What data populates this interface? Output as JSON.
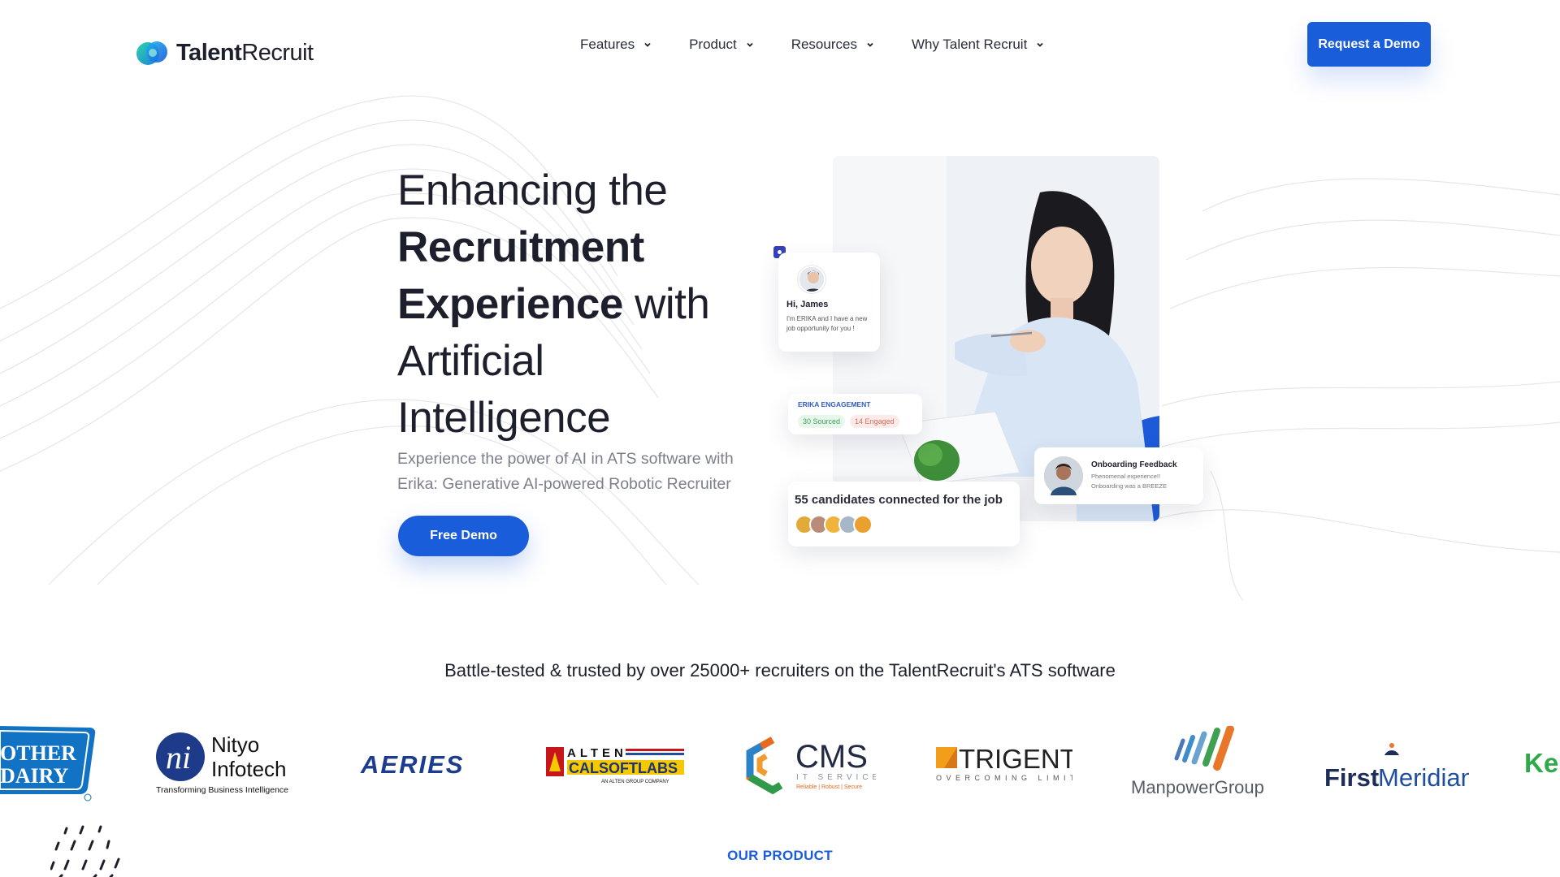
{
  "brand": {
    "name_bold": "Talent",
    "name_light": "Recruit",
    "accent": "#1a5ddb"
  },
  "nav": {
    "items": [
      {
        "label": "Features"
      },
      {
        "label": "Product"
      },
      {
        "label": "Resources"
      },
      {
        "label": "Why Talent Recruit"
      }
    ],
    "cta": "Request a Demo"
  },
  "hero": {
    "title_line1": "Enhancing the",
    "title_bold1": "Recruitment",
    "title_bold2": "Experience",
    "title_with": " with",
    "title_line4": "Artificial",
    "title_line5": "Intelligence",
    "subtitle": "Experience the power of AI in ATS software with Erika: Generative AI-powered Robotic Recruiter",
    "cta": "Free Demo"
  },
  "visual": {
    "greeting": "Hi, James",
    "greeting_msg": "I'm ERIKA and I have a new job opportunity for you !",
    "engagement_label": "ERIKA ENGAGEMENT",
    "sourced": "30 Sourced",
    "engaged": "14 Engaged",
    "onboarding_title": "Onboarding Feedback",
    "onboarding_msg": "Phenomenal experience!! Onboarding was a BREEZE",
    "candidates": "55 candidates connected for the job"
  },
  "trusted": "Battle-tested & trusted by over 25000+ recruiters on the TalentRecruit's ATS software",
  "logos": {
    "mother_dairy_1": "OTHER",
    "mother_dairy_2": "DAIRY",
    "nityo_1": "Nityo",
    "nityo_2": "Infotech",
    "nityo_tag": "Transforming Business Intelligence",
    "aeries": "AERIES",
    "alten_top": "ALTEN",
    "alten_main": "CALSOFTLABS",
    "alten_sub": "AN ALTEN GROUP COMPANY",
    "cms": "CMS",
    "cms_sub": "IT SERVICES",
    "cms_tag": "Reliable | Robust | Secure",
    "trigent": "TRIGENT",
    "trigent_sub": "OVERCOMING LIMITS",
    "manpower": "ManpowerGroup",
    "firstmeridian_1": "First",
    "firstmeridian_2": "Meridian",
    "kel": "Kel"
  },
  "section_label": "OUR PRODUCT"
}
